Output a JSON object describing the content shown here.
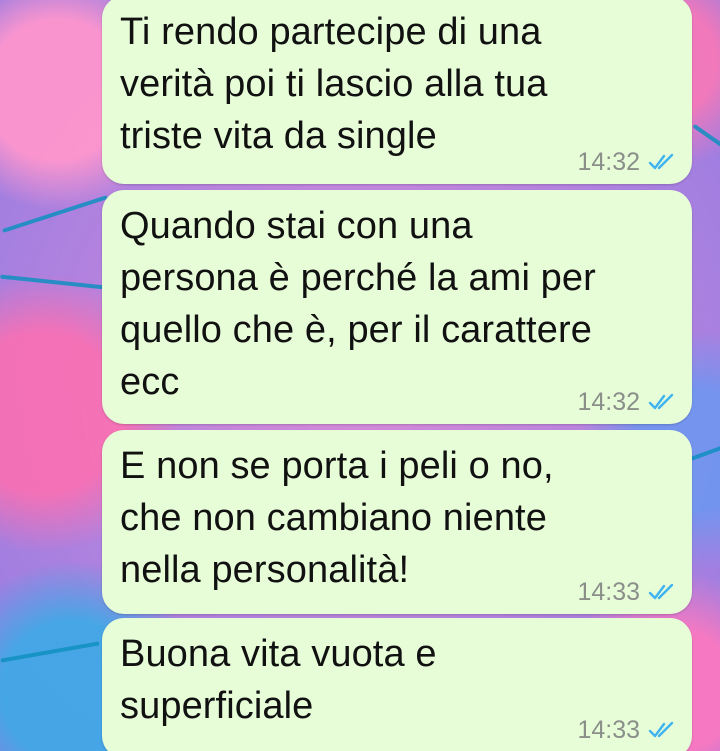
{
  "conversation": {
    "messages": [
      {
        "text": "Ti rendo partecipe di una\nverità poi ti lascio alla tua\ntriste vita da single",
        "time": "14:32",
        "status_icon": "double-check-read-icon"
      },
      {
        "text": "Quando stai con una\npersona è perché la ami per\nquello che è, per il carattere\necc",
        "time": "14:32",
        "status_icon": "double-check-read-icon"
      },
      {
        "text": "E non se porta i peli o no,\nche non cambiano niente\nnella personalità!",
        "time": "14:33",
        "status_icon": "double-check-read-icon"
      },
      {
        "text": "Buona vita vuota e\nsuperficiale",
        "time": "14:33",
        "status_icon": "double-check-read-icon"
      }
    ]
  },
  "colors": {
    "bubble_background": "#e7fdd8",
    "text": "#111111",
    "timestamp": "#8a8f8a",
    "read_ticks": "#3fb3f0"
  }
}
